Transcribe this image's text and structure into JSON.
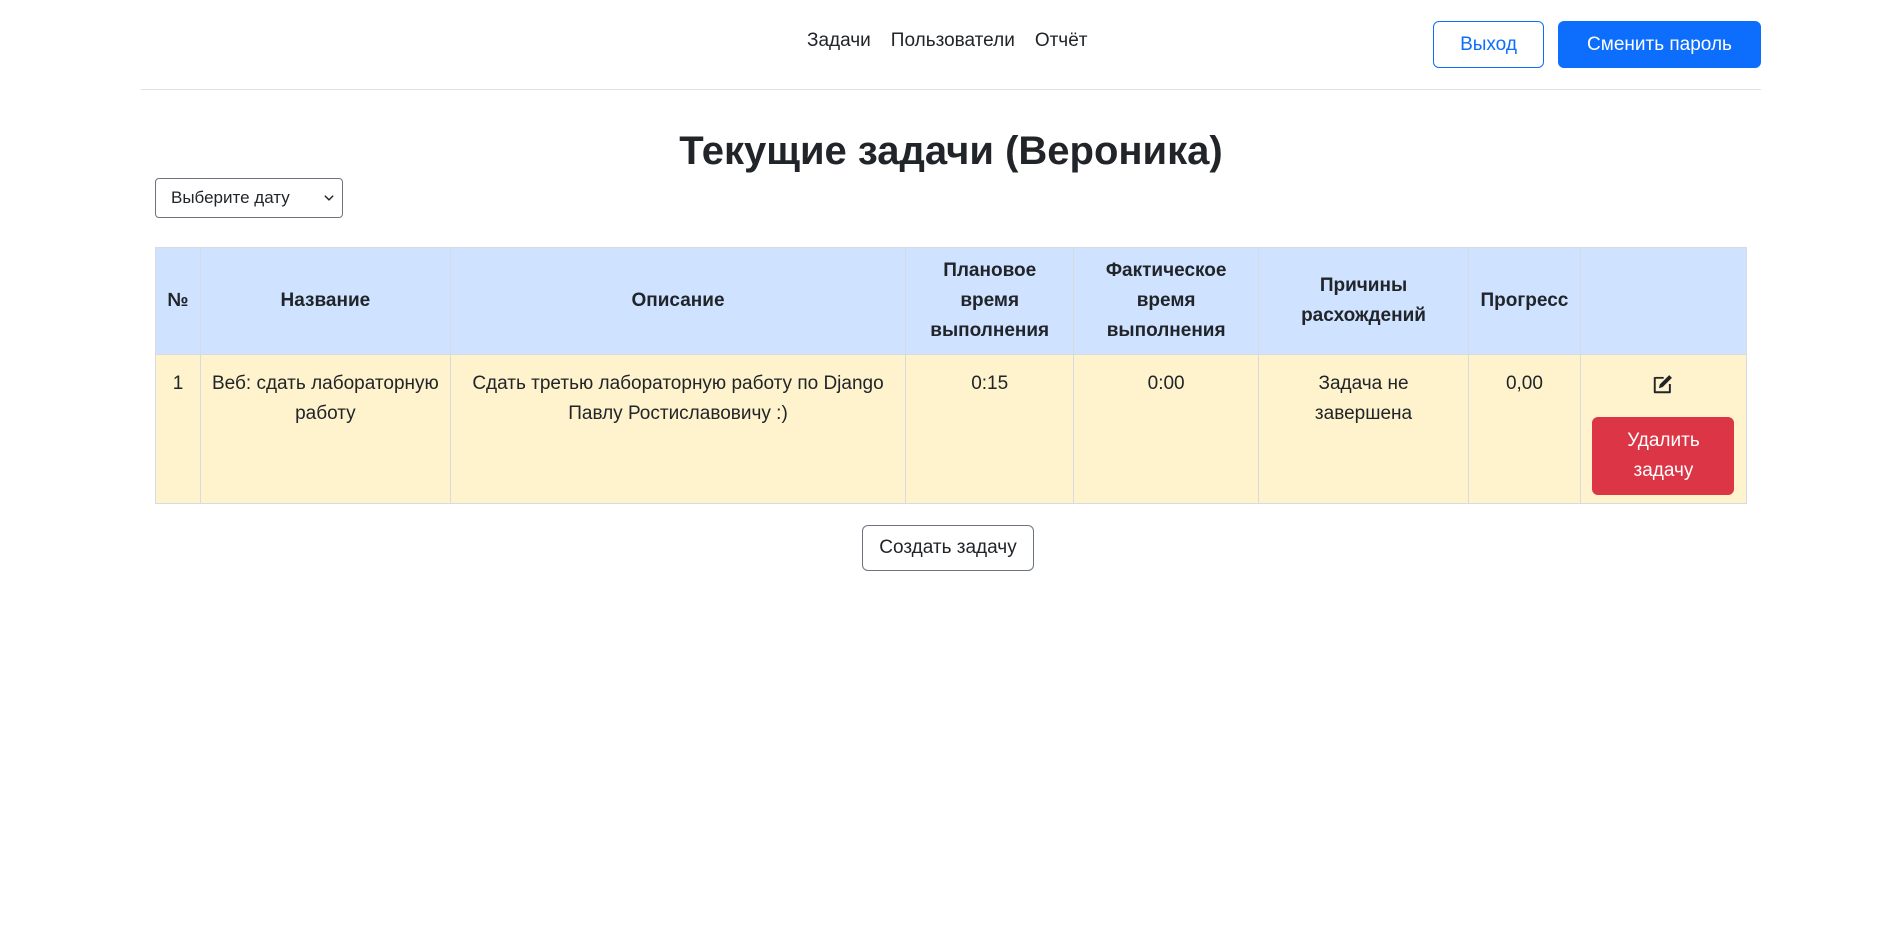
{
  "nav": {
    "items": [
      "Задачи",
      "Пользователи",
      "Отчёт"
    ],
    "logout_label": "Выход",
    "change_password_label": "Сменить пароль"
  },
  "page": {
    "title": "Текущие задачи (Вероника)",
    "date_select_value": "Выберите дату"
  },
  "table": {
    "headers": {
      "num": "№",
      "name": "Название",
      "description": "Описание",
      "planned_time": "Плановое время выполнения",
      "actual_time": "Фактическое время выполнения",
      "reasons": "Причины расхождений",
      "progress": "Прогресс",
      "actions": ""
    },
    "rows": [
      {
        "num": "1",
        "name": "Веб: сдать лабораторную работу",
        "description": "Сдать третью лабораторную работу по Django Павлу Ростиславовичу :)",
        "planned_time": "0:15",
        "actual_time": "0:00",
        "reasons": "Задача не завершена",
        "progress": "0,00",
        "delete_label": "Удалить задачу",
        "edit_icon": "edit-icon"
      }
    ]
  },
  "create_button_label": "Создать задачу",
  "colors": {
    "primary": "#0d6efd",
    "danger": "#dc3545",
    "header_bg": "#cfe2ff",
    "row_bg": "#fff3cd"
  }
}
